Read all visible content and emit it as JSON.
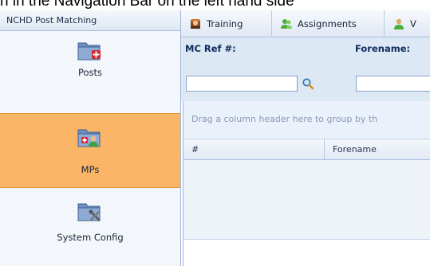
{
  "top_strip_text": "n in the Navigation Bar on the left hand side",
  "sidebar": {
    "title": "NCHD Post Matching",
    "items": [
      {
        "label": "Posts",
        "icon": "folder-red-plus-icon",
        "selected": false
      },
      {
        "label": "MPs",
        "icon": "folder-user-icon",
        "selected": true
      },
      {
        "label": "System Config",
        "icon": "folder-tools-icon",
        "selected": false
      }
    ]
  },
  "toolbar": {
    "items": [
      {
        "label": "Training",
        "icon": "training-icon"
      },
      {
        "label": "Assignments",
        "icon": "assignments-icon"
      },
      {
        "label": "V",
        "icon": "user-icon"
      }
    ]
  },
  "filters": {
    "mc_ref_label": "MC Ref #:",
    "forename_label": "Forename:",
    "mc_ref_value": "",
    "forename_value": ""
  },
  "grid": {
    "group_hint": "Drag a column header here to group by th",
    "columns": [
      "#",
      "Forename"
    ]
  },
  "colors": {
    "selected_nav": "#fbb566",
    "panel_blue": "#dde8f5",
    "label_blue": "#0d2a5c"
  }
}
